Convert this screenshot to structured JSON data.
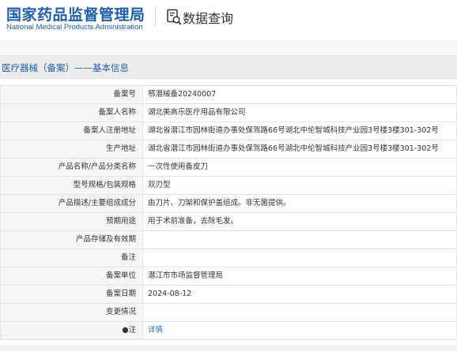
{
  "header": {
    "logo_cn": "国家药品监督管理局",
    "logo_en": "National Medical Products Administration",
    "title": "数据查询",
    "title_icon": "search-document-icon"
  },
  "section": {
    "title": "医疗器械（备案）——基本信息"
  },
  "rows": [
    {
      "label": "备案号",
      "value": "鄂潜械备20240007"
    },
    {
      "label": "备案人名称",
      "value": "湖北美高乐医疗用品有限公司"
    },
    {
      "label": "备案人注册地址",
      "value": "湖北省潜江市园林街道办事处保驾路66号湖北中伦智城科技产业园3号楼3楼301-302号"
    },
    {
      "label": "生产地址",
      "value": "湖北省潜江市园林街道办事处保驾路66号湖北中伦智城科技产业园3号楼3楼301-302号"
    },
    {
      "label": "产品名称/产品分类名称",
      "value": "一次性使用备皮刀"
    },
    {
      "label": "型号规格/包装规格",
      "value": "双刃型"
    },
    {
      "label": "产品描述/主要组成成分",
      "value": "由刀片、刀架和保护盖组成。非无菌提供。"
    },
    {
      "label": "预期用途",
      "value": "用于术前准备，去除毛发。"
    },
    {
      "label": "产品存储及有效期",
      "value": ""
    },
    {
      "label": "备注",
      "value": ""
    },
    {
      "label": "备案单位",
      "value": "潜江市市场监督管理局"
    },
    {
      "label": "备案日期",
      "value": "2024-08-12"
    },
    {
      "label": "变更情况",
      "value": ""
    },
    {
      "label": "●注",
      "value": "详情"
    }
  ],
  "colors": {
    "brand_blue": "#1f5fa8",
    "link_blue": "#1f6fc5"
  }
}
